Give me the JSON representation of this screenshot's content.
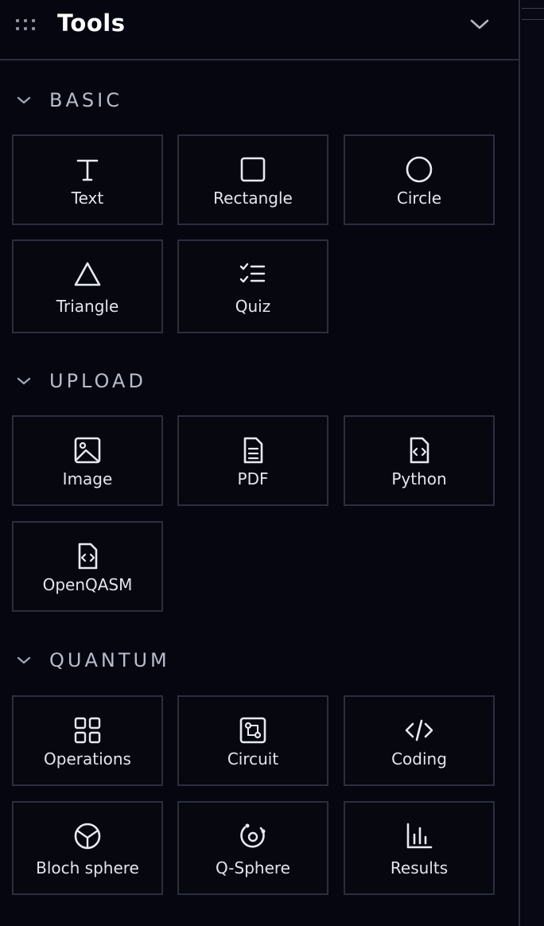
{
  "header": {
    "title": "Tools"
  },
  "sections": [
    {
      "label": "BASIC",
      "items": [
        {
          "label": "Text",
          "icon": "text-icon"
        },
        {
          "label": "Rectangle",
          "icon": "rectangle-icon"
        },
        {
          "label": "Circle",
          "icon": "circle-icon"
        },
        {
          "label": "Triangle",
          "icon": "triangle-icon"
        },
        {
          "label": "Quiz",
          "icon": "checklist-icon"
        }
      ]
    },
    {
      "label": "UPLOAD",
      "items": [
        {
          "label": "Image",
          "icon": "image-icon"
        },
        {
          "label": "PDF",
          "icon": "document-icon"
        },
        {
          "label": "Python",
          "icon": "code-file-icon"
        },
        {
          "label": "OpenQASM",
          "icon": "code-file-icon"
        }
      ]
    },
    {
      "label": "QUANTUM",
      "items": [
        {
          "label": "Operations",
          "icon": "grid-icon"
        },
        {
          "label": "Circuit",
          "icon": "circuit-icon"
        },
        {
          "label": "Coding",
          "icon": "code-icon"
        },
        {
          "label": "Bloch sphere",
          "icon": "bloch-sphere-icon"
        },
        {
          "label": "Q-Sphere",
          "icon": "q-sphere-icon"
        },
        {
          "label": "Results",
          "icon": "bar-chart-icon"
        }
      ]
    }
  ]
}
